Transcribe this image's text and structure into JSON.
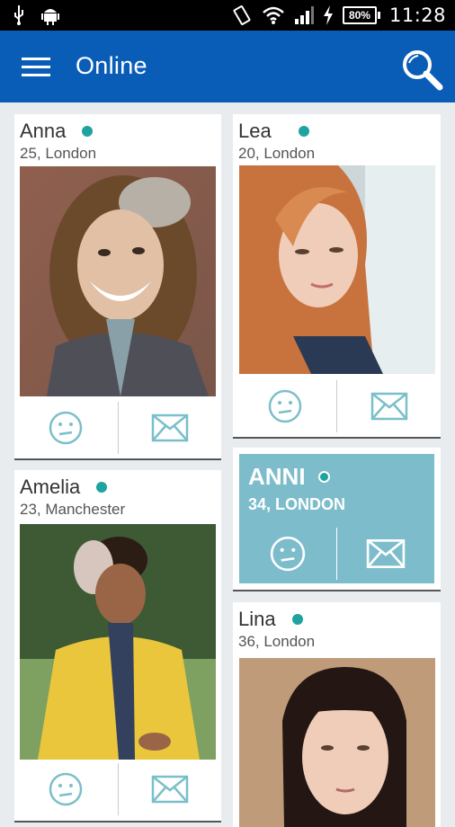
{
  "status_bar": {
    "time": "11:28",
    "battery": "80%",
    "icons": [
      "usb-icon",
      "android-icon",
      "vibrate-icon",
      "wifi-icon",
      "signal-icon",
      "charging-icon"
    ]
  },
  "appbar": {
    "title": "Online",
    "menu_icon": "menu-icon",
    "search_icon": "search-icon",
    "color": "#0a5db7"
  },
  "profiles": [
    {
      "name": "Anna",
      "info": "25, London",
      "online": true
    },
    {
      "name": "Lea",
      "info": "20, London",
      "online": true
    },
    {
      "name": "Amelia",
      "info": "23, Manchester",
      "online": true
    },
    {
      "name": "ANNI",
      "info": "34, LONDON",
      "online": true,
      "highlighted": true
    },
    {
      "name": "Lina",
      "info": "36, London",
      "online": true
    }
  ],
  "colors": {
    "online_dot": "#1fa3a0",
    "highlight": "#7dbccb",
    "action_icon": "#7bbfc9"
  }
}
